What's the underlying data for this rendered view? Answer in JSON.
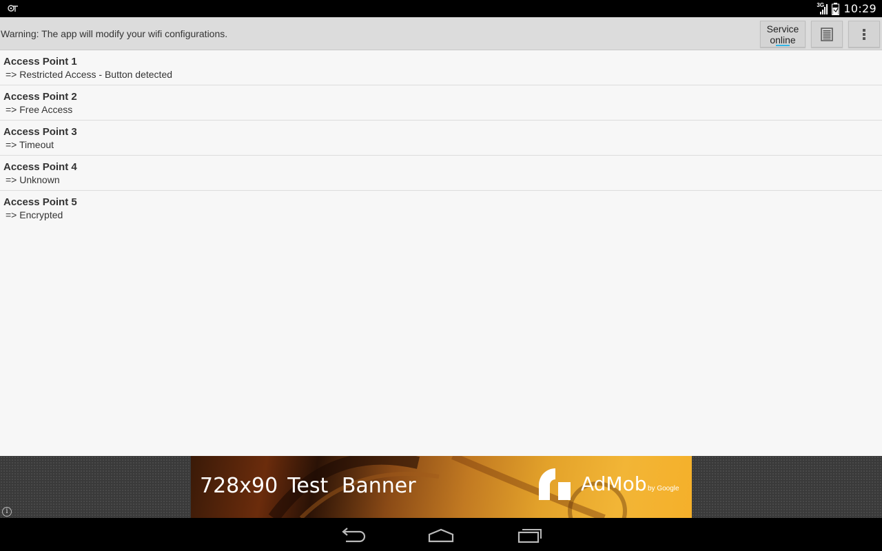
{
  "status_bar": {
    "time": "10:29",
    "network_label": "3G"
  },
  "action_bar": {
    "warning": "Warning: The app will modify your wifi configurations.",
    "service_line1": "Service",
    "service_line2": "online",
    "accent_color": "#33b5e5"
  },
  "access_points": [
    {
      "name": "Access Point 1",
      "status": "=> Restricted Access - Button detected"
    },
    {
      "name": "Access Point 2",
      "status": "=> Free Access"
    },
    {
      "name": "Access Point 3",
      "status": "=> Timeout"
    },
    {
      "name": "Access Point 4",
      "status": "=> Unknown"
    },
    {
      "name": "Access Point 5",
      "status": "=> Encrypted"
    }
  ],
  "ad": {
    "size": "728x90",
    "label": "Test Banner",
    "brand": "AdMob",
    "brand_by": "by Google"
  },
  "icons": {
    "notification": "wifi-notification-icon",
    "signal": "signal-icon",
    "battery": "battery-icon",
    "log": "log-list-icon",
    "overflow": "overflow-menu-icon",
    "back": "back-icon",
    "home": "home-icon",
    "recents": "recents-icon"
  }
}
